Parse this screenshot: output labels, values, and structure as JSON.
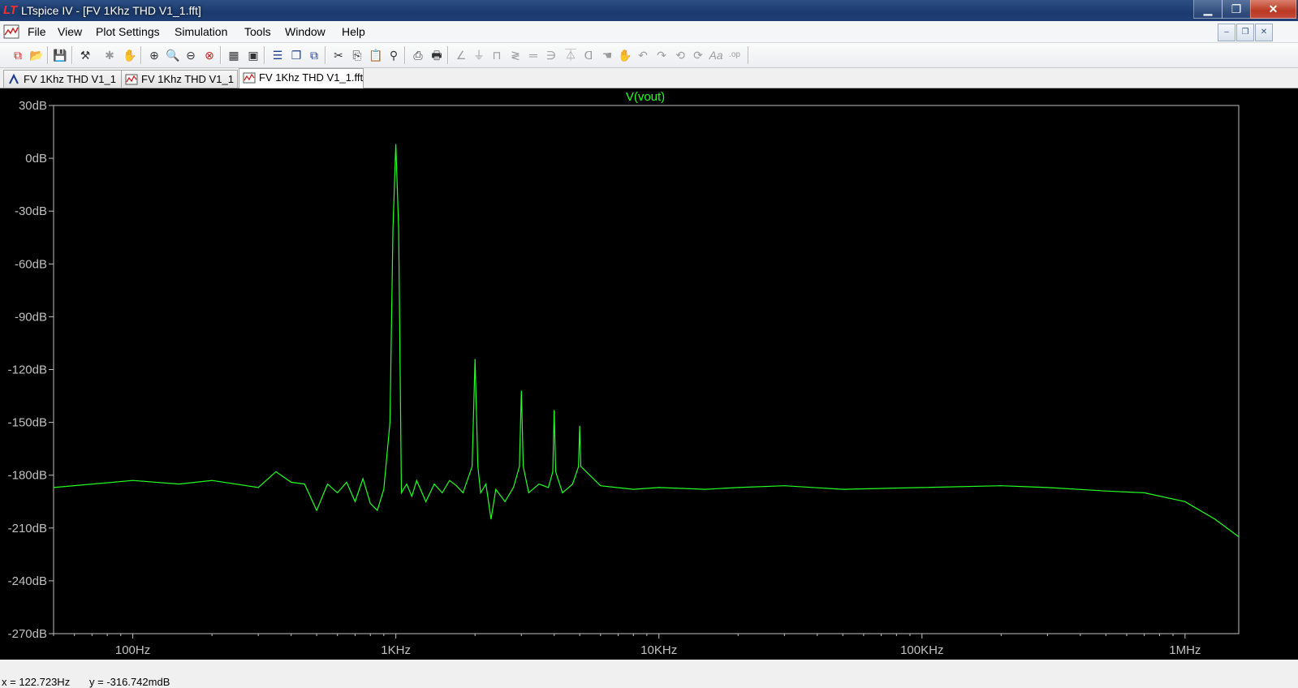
{
  "window": {
    "title": "LTspice IV - [FV 1Khz THD V1_1.fft]",
    "minimize": "▁",
    "maximize": "❐",
    "close": "✕"
  },
  "menu": [
    "File",
    "View",
    "Plot Settings",
    "Simulation",
    "Tools",
    "Window",
    "Help"
  ],
  "mdi_controls": {
    "minimize": "–",
    "restore": "❐",
    "close": "✕"
  },
  "tabs": [
    {
      "label": "FV 1Khz THD V1_1",
      "icon": "schematic-icon",
      "active": false
    },
    {
      "label": "FV 1Khz THD V1_1",
      "icon": "waveform-icon",
      "active": false
    },
    {
      "label": "FV 1Khz THD V1_1.fft",
      "icon": "waveform-icon",
      "active": true
    }
  ],
  "status": {
    "x": "x = 122.723Hz",
    "y": "y = -316.742mdB"
  },
  "colors": {
    "trace": "#22ff22",
    "plot_bg": "#000000",
    "axis": "#c0c0c0"
  },
  "chart_data": {
    "type": "line",
    "title": "V(vout)",
    "x_scale": "log",
    "xlim": [
      50,
      1600000
    ],
    "ylim": [
      -270,
      30
    ],
    "y_ticks": [
      "30dB",
      "0dB",
      "-30dB",
      "-60dB",
      "-90dB",
      "-120dB",
      "-150dB",
      "-180dB",
      "-210dB",
      "-240dB",
      "-270dB"
    ],
    "x_ticks": [
      "100Hz",
      "1KHz",
      "10KHz",
      "100KHz",
      "1MHz"
    ],
    "x_tick_values": [
      100,
      1000,
      10000,
      100000,
      1000000
    ],
    "series": [
      {
        "name": "V(vout)",
        "x": [
          50,
          100,
          150,
          200,
          300,
          350,
          400,
          450,
          500,
          550,
          600,
          650,
          700,
          750,
          800,
          850,
          900,
          950,
          975,
          1000,
          1025,
          1050,
          1100,
          1150,
          1200,
          1300,
          1400,
          1500,
          1600,
          1700,
          1800,
          1950,
          2000,
          2050,
          2100,
          2200,
          2300,
          2400,
          2600,
          2800,
          2950,
          3000,
          3050,
          3200,
          3500,
          3800,
          3950,
          4000,
          4050,
          4300,
          4700,
          4950,
          5000,
          5050,
          6000,
          8000,
          10000,
          15000,
          20000,
          30000,
          50000,
          100000,
          200000,
          300000,
          500000,
          700000,
          1000000,
          1300000,
          1600000
        ],
        "y": [
          -187,
          -183,
          -185,
          -183,
          -187,
          -178,
          -184,
          -185,
          -200,
          -185,
          -190,
          -184,
          -195,
          -182,
          -196,
          -200,
          -188,
          -150,
          -40,
          8,
          -40,
          -190,
          -185,
          -192,
          -183,
          -195,
          -185,
          -190,
          -183,
          -186,
          -190,
          -175,
          -114,
          -175,
          -190,
          -185,
          -205,
          -188,
          -195,
          -187,
          -175,
          -132,
          -175,
          -190,
          -185,
          -187,
          -178,
          -143,
          -178,
          -190,
          -185,
          -175,
          -152,
          -175,
          -186,
          -188,
          -187,
          -188,
          -187,
          -186,
          -188,
          -187,
          -186,
          -187,
          -189,
          -190,
          -195,
          -205,
          -215
        ]
      }
    ]
  }
}
